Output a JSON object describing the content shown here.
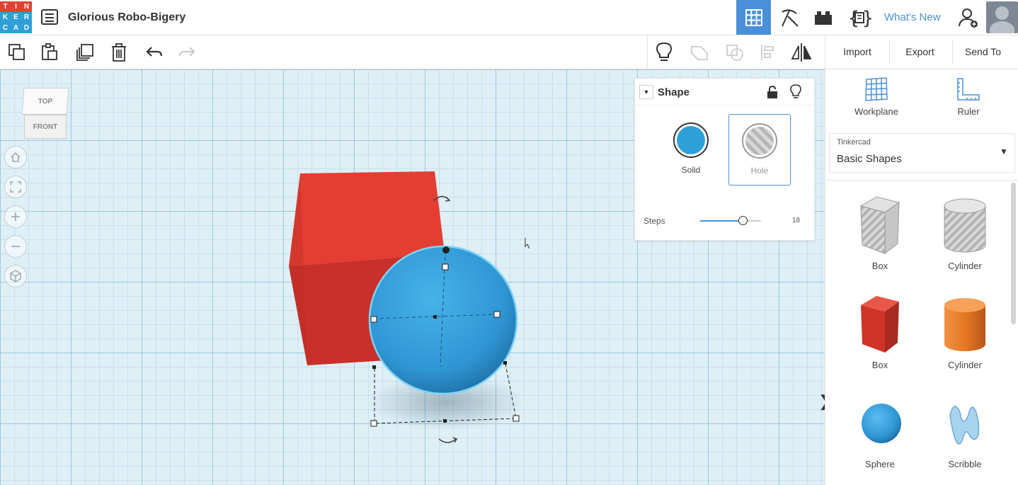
{
  "app": {
    "logo_letters": [
      "T",
      "I",
      "N",
      "K",
      "E",
      "R",
      "C",
      "A",
      "D"
    ],
    "logo_colors": [
      "#e14231",
      "#e14231",
      "#e14231",
      "#2f9fd7",
      "#2f9fd7",
      "#2f9fd7",
      "#2f9fd7",
      "#2f9fd7",
      "#2f9fd7"
    ],
    "design_title": "Glorious Robo-Bigery",
    "accent_color": "#4a90d9"
  },
  "header": {
    "whats_new": "What's New",
    "icons": [
      "menu-icon",
      "grid-icon",
      "pickaxe-icon",
      "brick-icon",
      "code-blocks-icon",
      "add-user-icon",
      "avatar"
    ]
  },
  "toolbar": {
    "import_label": "Import",
    "export_label": "Export",
    "send_to_label": "Send To",
    "icons": [
      "copy-icon",
      "paste-icon",
      "duplicate-icon",
      "trash-icon",
      "undo-icon",
      "redo-icon",
      "lightbulb-icon",
      "group-icon",
      "ungroup-icon",
      "align-icon",
      "mirror-icon"
    ]
  },
  "viewcube": {
    "top_label": "TOP",
    "front_label": "FRONT"
  },
  "shape_panel": {
    "title": "Shape",
    "solid_label": "Solid",
    "hole_label": "Hole",
    "solid_color": "#2f9fd7",
    "steps_label": "Steps",
    "steps_value": "18",
    "steps_fraction": 0.7
  },
  "side_panel": {
    "workplane_label": "Workplane",
    "ruler_label": "Ruler",
    "library_category": "Tinkercad",
    "library_name": "Basic Shapes",
    "shapes": [
      {
        "label": "Box",
        "kind": "box-hole"
      },
      {
        "label": "Cylinder",
        "kind": "cylinder-hole"
      },
      {
        "label": "Box",
        "kind": "box-red"
      },
      {
        "label": "Cylinder",
        "kind": "cylinder-orange"
      },
      {
        "label": "Sphere",
        "kind": "sphere-blue"
      },
      {
        "label": "Scribble",
        "kind": "scribble"
      }
    ]
  },
  "scene": {
    "box_color": "#e03c31",
    "sphere_color": "#2f96d4"
  }
}
